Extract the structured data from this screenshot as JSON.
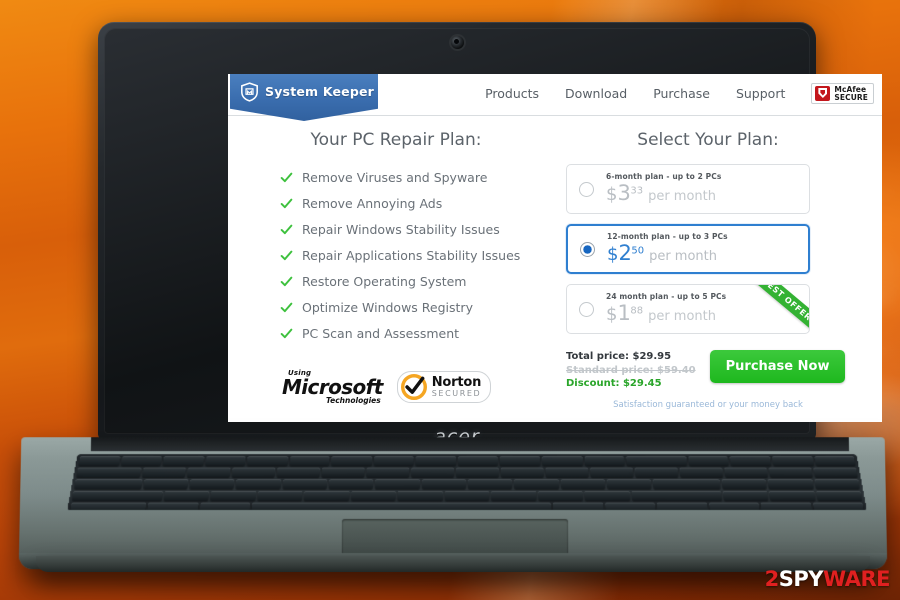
{
  "site": {
    "brand_name": "System Keeper",
    "brand_icon": "shield-icon",
    "nav": [
      {
        "label": "Products"
      },
      {
        "label": "Download"
      },
      {
        "label": "Purchase"
      },
      {
        "label": "Support"
      }
    ],
    "mcafee_badge": {
      "line1": "McAfee",
      "line2": "SECURE",
      "icon": "mcafee-shield-icon"
    }
  },
  "left": {
    "title": "Your PC Repair Plan:",
    "features": [
      {
        "label": "Remove Viruses and Spyware",
        "icon": "check-icon"
      },
      {
        "label": "Remove Annoying Ads",
        "icon": "check-icon"
      },
      {
        "label": "Repair Windows Stability Issues",
        "icon": "check-icon"
      },
      {
        "label": "Repair Applications Stability Issues",
        "icon": "check-icon"
      },
      {
        "label": "Restore Operating System",
        "icon": "check-icon"
      },
      {
        "label": "Optimize Windows Registry",
        "icon": "check-icon"
      },
      {
        "label": "PC Scan and Assessment",
        "icon": "check-icon"
      }
    ],
    "badges": {
      "microsoft": {
        "using": "Using",
        "name": "Microsoft",
        "sub": "Technologies"
      },
      "norton": {
        "name": "Norton",
        "sub": "SECURED",
        "icon": "norton-check-icon"
      }
    }
  },
  "right": {
    "title": "Select Your Plan:",
    "plans": [
      {
        "sub": "6-month plan - up to 2 PCs",
        "currency": "$",
        "amount": "3",
        "cents": "33",
        "per": "per month",
        "selected": false,
        "ribbon": ""
      },
      {
        "sub": "12-month plan - up to 3 PCs",
        "currency": "$",
        "amount": "2",
        "cents": "50",
        "per": "per month",
        "selected": true,
        "ribbon": ""
      },
      {
        "sub": "24 month plan - up to 5 PCs",
        "currency": "$",
        "amount": "1",
        "cents": "88",
        "per": "per month",
        "selected": false,
        "ribbon": "BEST OFFER"
      }
    ],
    "summary": {
      "total": "Total price: $29.95",
      "standard": "Standard price: $59.40",
      "discount": "Discount: $29.45"
    },
    "buy_button": "Purchase Now",
    "guarantee": "Satisfaction guaranteed or your money back"
  },
  "device": {
    "brand": "acer"
  },
  "watermark": {
    "part1": "2",
    "part2": "SPY",
    "part3": "WARE"
  },
  "colors": {
    "brand_blue": "#3a6dae",
    "accent_blue": "#2f7fd0",
    "green": "#34b233",
    "buy_green": "#1eb81e",
    "discount_green": "#2aa52a",
    "mcafee_red": "#c3161c",
    "norton_orange": "#f5a623",
    "background_orange": "#e8720c"
  }
}
